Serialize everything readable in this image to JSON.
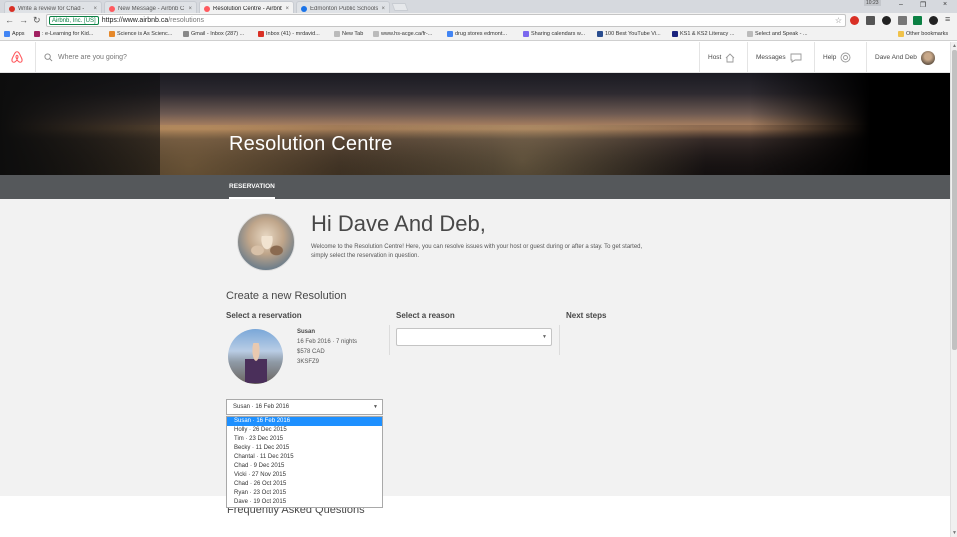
{
  "browser": {
    "tabs": [
      {
        "label": "Write a review for Chad -",
        "color": "#d93025"
      },
      {
        "label": "New Message - Airbnb C",
        "color": "#ff5a5f"
      },
      {
        "label": "Resolution Centre - Airbnb",
        "color": "#ff5a5f",
        "active": true
      },
      {
        "label": "Edmonton Public Schools",
        "color": "#1a73e8"
      }
    ],
    "clock": "10:23",
    "secure_label": "Airbnb, Inc. [US]",
    "url_main": "https://www.airbnb.ca",
    "url_path": "/resolutions",
    "bookmarks": [
      {
        "label": "Apps",
        "color": "#4285f4"
      },
      {
        "label": ": e-Learning for Kid...",
        "color": "#a02060"
      },
      {
        "label": "Science is As Scienc...",
        "color": "#e6892b"
      },
      {
        "label": "Gmail - Inbox (287) ...",
        "color": "#888"
      },
      {
        "label": "Inbox (41) - mrdavid...",
        "color": "#d93025"
      },
      {
        "label": "New Tab",
        "color": "#bbb"
      },
      {
        "label": "www.hs-acge.ca/fr-...",
        "color": "#bbb"
      },
      {
        "label": "drug stores edmont...",
        "color": "#4285f4"
      },
      {
        "label": "Sharing calendars w...",
        "color": "#7b68ee"
      },
      {
        "label": "100 Best YouTube Vi...",
        "color": "#2a4d8f"
      },
      {
        "label": "KS1 & KS2 Literacy ...",
        "color": "#1a237e"
      },
      {
        "label": "Select and Speak - ...",
        "color": "#bbb"
      },
      {
        "label": "Other bookmarks",
        "color": "#f0c24a"
      }
    ]
  },
  "header": {
    "search_placeholder": "Where are you going?",
    "host_label": "Host",
    "messages_label": "Messages",
    "help_label": "Help",
    "user_name": "Dave And Deb"
  },
  "hero": {
    "title": "Resolution Centre",
    "tab_label": "RESERVATION"
  },
  "main": {
    "greeting": "Hi Dave And Deb,",
    "welcome_line1": "Welcome to the Resolution Centre! Here, you can resolve issues with your host or guest during or after a stay. To get started,",
    "welcome_line2": "simply select the reservation in question.",
    "section_title": "Create a new Resolution",
    "col_reservation": "Select a reservation",
    "col_reason": "Select a reason",
    "col_next": "Next steps",
    "guest": {
      "name": "Susan",
      "dates": "16 Feb 2016 · 7 nights",
      "price": "$578 CAD",
      "code": "3KSFZ9"
    },
    "reservation_select_value": "Susan · 16 Feb 2016",
    "reservation_options": [
      "Susan · 16 Feb 2016",
      "Holly · 26 Dec 2015",
      "Tim · 23 Dec 2015",
      "Becky · 11 Dec 2015",
      "Chantal · 11 Dec 2015",
      "Chad · 9 Dec 2015",
      "Vicki · 27 Nov 2015",
      "Chad · 26 Oct 2015",
      "Ryan · 23 Oct 2015",
      "Dave · 19 Oct 2015"
    ],
    "faq_title": "Frequently Asked Questions"
  }
}
